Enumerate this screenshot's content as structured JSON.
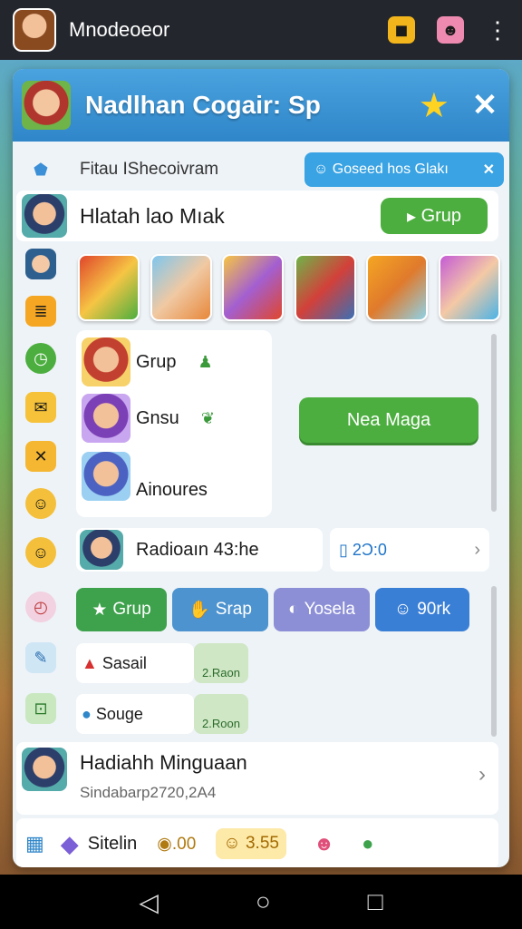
{
  "topbar": {
    "title": "Mnodeoeor"
  },
  "dialog": {
    "title": "Nadlhan Cogair: Sp",
    "close_label": "✕"
  },
  "filter": {
    "label": "Fitau IShecoivram",
    "pill": "Goseed hos Glakı",
    "pill_close": "✕"
  },
  "group_row": {
    "label": "Hlatah lao Mıak",
    "button": "Grup"
  },
  "players": [
    {
      "name": "Grup",
      "emoji": "♟"
    },
    {
      "name": "Gnsu",
      "emoji": "❦"
    },
    {
      "name": "Ainoures",
      "emoji": "❦"
    }
  ],
  "mega_button": "Nea Maga",
  "radio_row": {
    "label": "Radioaın 43:he",
    "count": "2Ɔ:0"
  },
  "tabs": [
    {
      "label": "Grup",
      "icon": "★",
      "color": "#3ea24c"
    },
    {
      "label": "Srap",
      "icon": "✋",
      "color": "#4d93cf"
    },
    {
      "label": "Yosela",
      "icon": "◐",
      "color": "#8c8fd6"
    },
    {
      "label": "90rk",
      "icon": "☺",
      "color": "#3a7fd6"
    }
  ],
  "items": [
    {
      "name": "Sasail",
      "badge": "2.Raon",
      "icon": "▲"
    },
    {
      "name": "Souge",
      "badge": "2.Roon",
      "icon": "●"
    }
  ],
  "reward": {
    "title": "Hadiahh Minguaan",
    "subtitle": "Sindabarp2720,2A4"
  },
  "bottom": {
    "label": "Sitelin",
    "coins": ".00",
    "gold": "3.55"
  },
  "colors": {
    "accent": "#2f86c9",
    "green": "#4cae3f"
  }
}
